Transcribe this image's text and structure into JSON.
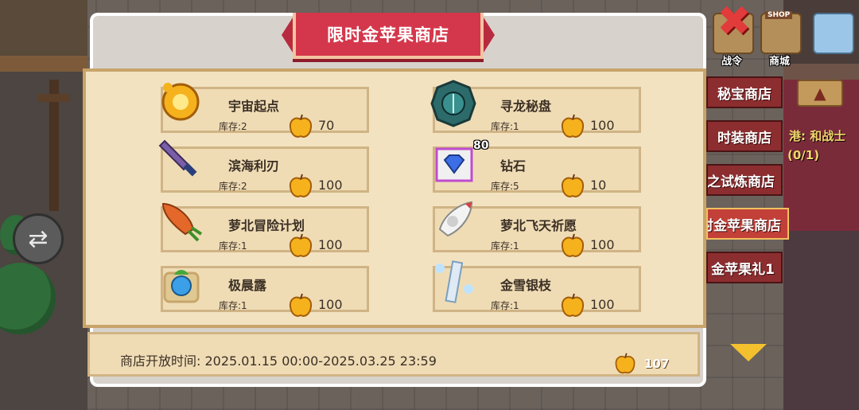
{
  "shop": {
    "title": "限时金苹果商店",
    "open_time_label": "商店开放时间:",
    "open_time_value": "2025.01.15 00:00-2025.03.25 23:59",
    "currency_icon": "golden-apple-icon",
    "currency_count": "107"
  },
  "items": [
    {
      "name": "宇宙起点",
      "stock_label": "库存:2",
      "price": "70",
      "icon": "cosmic-origin-icon"
    },
    {
      "name": "寻龙秘盘",
      "stock_label": "库存:1",
      "price": "100",
      "icon": "dragon-compass-icon"
    },
    {
      "name": "滨海利刃",
      "stock_label": "库存:2",
      "price": "100",
      "icon": "seaside-blade-icon"
    },
    {
      "name": "钻石",
      "stock_label": "库存:5",
      "price": "10",
      "icon": "diamond-icon",
      "badge": "80"
    },
    {
      "name": "萝北冒险计划",
      "stock_label": "库存:1",
      "price": "100",
      "icon": "carrot-rocket-icon"
    },
    {
      "name": "萝北飞天祈愿",
      "stock_label": "库存:1",
      "price": "100",
      "icon": "bunny-rocket-icon"
    },
    {
      "name": "极晨露",
      "stock_label": "库存:1",
      "price": "100",
      "icon": "dew-orb-icon"
    },
    {
      "name": "金雪银枝",
      "stock_label": "库存:1",
      "price": "100",
      "icon": "snow-branch-icon"
    }
  ],
  "side_tabs": [
    {
      "label": "秘宝商店",
      "active": false
    },
    {
      "label": "时装商店",
      "active": false
    },
    {
      "label": "之试炼商店",
      "active": false
    },
    {
      "label": "时金苹果商店",
      "active": true
    },
    {
      "label": "金苹果礼1",
      "active": false
    }
  ],
  "hud": {
    "battle_pass_label": "战令",
    "mall_label": "商城",
    "shop_sign": "SHOP"
  },
  "quest": {
    "text": "港: 和战士",
    "progress": "(0/1)"
  },
  "colors": {
    "banner": "#d4374b",
    "panel": "#f3e2c0",
    "card": "#efdcb5",
    "active_tab": "#c24038",
    "apple": "#f5b21c"
  }
}
